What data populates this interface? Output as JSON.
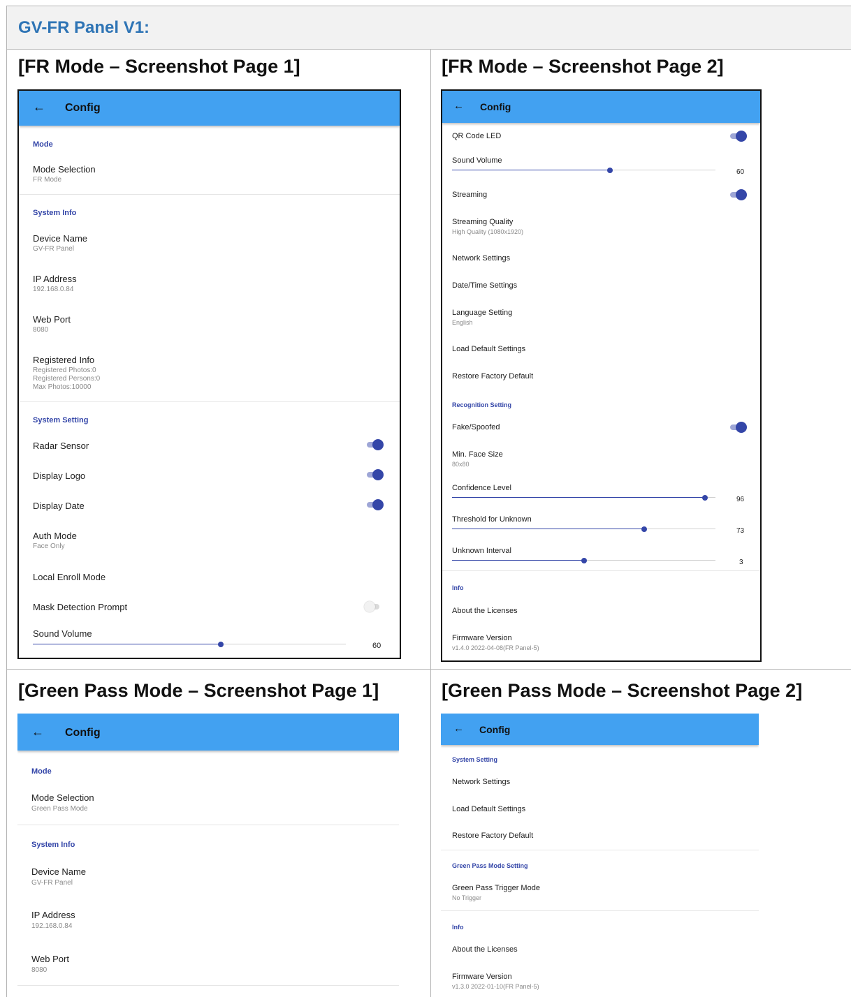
{
  "doc": {
    "heading": "GV-FR Panel V1:",
    "cells": {
      "fr1": "[FR Mode – Screenshot Page 1]",
      "fr2": "[FR Mode – Screenshot Page 2]",
      "gp1": "[Green Pass Mode – Screenshot Page 1]",
      "gp2": "[Green Pass Mode – Screenshot Page 2]"
    }
  },
  "colors": {
    "appbar": "#42a1f1",
    "accent": "#3446a8",
    "doc_heading": "#2e74b5"
  },
  "icons": {
    "back": "arrow-left-icon"
  },
  "fr_page1": {
    "appbar_title": "Config",
    "sections": {
      "mode": "Mode",
      "system_info": "System Info",
      "system_setting": "System Setting"
    },
    "mode_selection": {
      "title": "Mode Selection",
      "value": "FR Mode"
    },
    "device_name": {
      "title": "Device Name",
      "value": "GV-FR Panel"
    },
    "ip_address": {
      "title": "IP Address",
      "value": "192.168.0.84"
    },
    "web_port": {
      "title": "Web Port",
      "value": "8080"
    },
    "registered_info": {
      "title": "Registered Info",
      "lines": [
        "Registered Photos:0",
        "Registered Persons:0",
        "Max Photos:10000"
      ]
    },
    "radar_sensor": {
      "title": "Radar Sensor",
      "on": true
    },
    "display_logo": {
      "title": "Display Logo",
      "on": true
    },
    "display_date": {
      "title": "Display Date",
      "on": true
    },
    "auth_mode": {
      "title": "Auth Mode",
      "value": "Face Only"
    },
    "local_enroll_mode": {
      "title": "Local Enroll Mode"
    },
    "mask_detection_prompt": {
      "title": "Mask Detection Prompt",
      "on": false
    },
    "sound_volume": {
      "title": "Sound Volume",
      "value": 60,
      "max": 100,
      "value_text": "60"
    }
  },
  "fr_page2": {
    "appbar_title": "Config",
    "qr_code_led": {
      "title": "QR Code LED",
      "on": true
    },
    "sound_volume": {
      "title": "Sound Volume",
      "value": 60,
      "max": 100,
      "value_text": "60"
    },
    "streaming": {
      "title": "Streaming",
      "on": true
    },
    "streaming_quality": {
      "title": "Streaming Quality",
      "value": "High Quality (1080x1920)"
    },
    "network_settings": {
      "title": "Network Settings"
    },
    "datetime_settings": {
      "title": "Date/Time Settings"
    },
    "language_setting": {
      "title": "Language Setting",
      "value": "English"
    },
    "load_default_settings": {
      "title": "Load Default Settings"
    },
    "restore_factory_default": {
      "title": "Restore Factory Default"
    },
    "sections": {
      "recognition_setting": "Recognition Setting",
      "info": "Info"
    },
    "fake_spoofed": {
      "title": "Fake/Spoofed",
      "on": true
    },
    "min_face_size": {
      "title": "Min. Face Size",
      "value": "80x80"
    },
    "confidence_level": {
      "title": "Confidence Level",
      "value": 96,
      "max": 100,
      "value_text": "96"
    },
    "threshold_for_unknown": {
      "title": "Threshold for Unknown",
      "value": 73,
      "max": 100,
      "value_text": "73"
    },
    "unknown_interval": {
      "title": "Unknown Interval",
      "value": 3,
      "max": 6,
      "value_text": "3"
    },
    "about_licenses": {
      "title": "About the Licenses"
    },
    "firmware_version": {
      "title": "Firmware Version",
      "value": "v1.4.0 2022-04-08(FR Panel-5)"
    }
  },
  "gp_page1": {
    "appbar_title": "Config",
    "sections": {
      "mode": "Mode",
      "system_info": "System Info"
    },
    "mode_selection": {
      "title": "Mode Selection",
      "value": "Green Pass Mode"
    },
    "device_name": {
      "title": "Device Name",
      "value": "GV-FR Panel"
    },
    "ip_address": {
      "title": "IP Address",
      "value": "192.168.0.84"
    },
    "web_port": {
      "title": "Web Port",
      "value": "8080"
    }
  },
  "gp_page2": {
    "appbar_title": "Config",
    "sections": {
      "system_setting": "System Setting",
      "green_pass_mode_setting": "Green Pass Mode Setting",
      "info": "Info"
    },
    "network_settings": {
      "title": "Network Settings"
    },
    "load_default_settings": {
      "title": "Load Default Settings"
    },
    "restore_factory_default": {
      "title": "Restore Factory Default"
    },
    "green_pass_trigger_mode": {
      "title": "Green Pass Trigger Mode",
      "value": "No Trigger"
    },
    "about_licenses": {
      "title": "About the Licenses"
    },
    "firmware_version": {
      "title": "Firmware Version",
      "value": "v1.3.0 2022-01-10(FR Panel-5)"
    }
  }
}
